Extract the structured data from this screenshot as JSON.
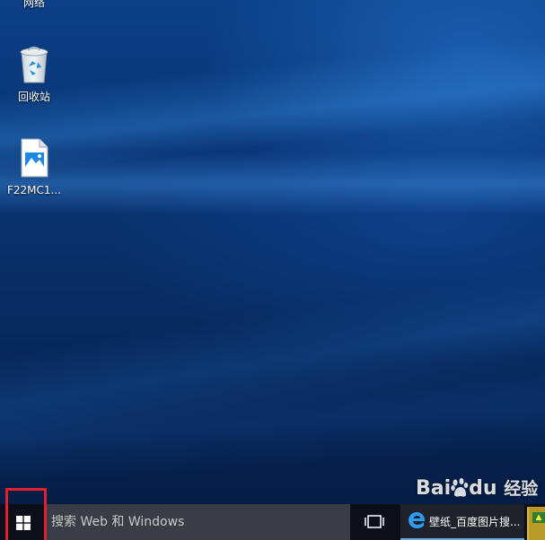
{
  "desktop": {
    "icons": [
      {
        "label": "网络",
        "icon": "network-icon"
      },
      {
        "label": "回收站",
        "icon": "recycle-bin-icon"
      },
      {
        "label": "F22MC1...",
        "icon": "image-file-icon"
      }
    ]
  },
  "taskbar": {
    "start_icon": "windows-logo-icon",
    "search_placeholder": "搜索 Web 和 Windows",
    "task_view_icon": "task-view-icon",
    "edge_window_title": "壁纸_百度图片搜...",
    "edge_icon": "edge-browser-icon",
    "pinned_app_icon": "app-icon"
  },
  "watermark": {
    "brand": "Bai",
    "brand_tail": "du",
    "sub": "经验"
  },
  "colors": {
    "highlight_border": "#e0202c",
    "taskbar_bg": "#0c0f1a",
    "search_bg": "#3a3d46",
    "desktop_blue": "#0a3676"
  }
}
